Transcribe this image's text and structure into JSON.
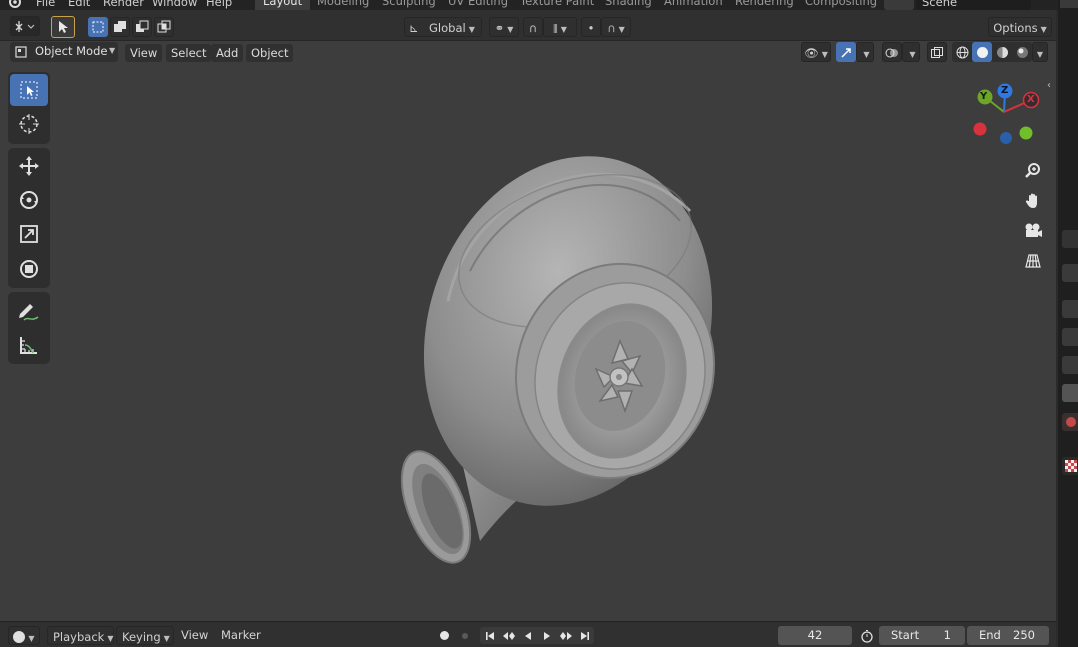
{
  "topbar": {
    "menus": [
      "File",
      "Edit",
      "Render",
      "Window",
      "Help"
    ],
    "workspaces": [
      "Layout",
      "Modeling",
      "Sculpting",
      "UV Editing",
      "Texture Paint",
      "Shading",
      "Animation",
      "Rendering",
      "Compositing"
    ],
    "active_workspace": "Layout",
    "scene_name": "Scene"
  },
  "tool_header": {
    "orientation": "Global",
    "options_label": "Options"
  },
  "viewport_header": {
    "mode": "Object Mode",
    "menus": [
      "View",
      "Select",
      "Add",
      "Object"
    ]
  },
  "left_toolbar": {
    "tools": [
      "select-box",
      "cursor",
      "move",
      "rotate",
      "scale",
      "transform",
      "annotate",
      "measure"
    ],
    "active_tool": "select-box"
  },
  "gizmo": {
    "axes": [
      "X",
      "Y",
      "Z"
    ],
    "colors": {
      "x": "#d8323f",
      "y": "#6fa527",
      "z": "#2f79e0"
    }
  },
  "timeline": {
    "menus": [
      "Playback",
      "Keying",
      "View",
      "Marker"
    ],
    "current_frame": "42",
    "start_label": "Start",
    "start_value": "1",
    "end_label": "End",
    "end_value": "250"
  },
  "colors": {
    "accent": "#4772b3",
    "viewport_bg": "#3d3d3d",
    "header_bg": "#303030"
  }
}
